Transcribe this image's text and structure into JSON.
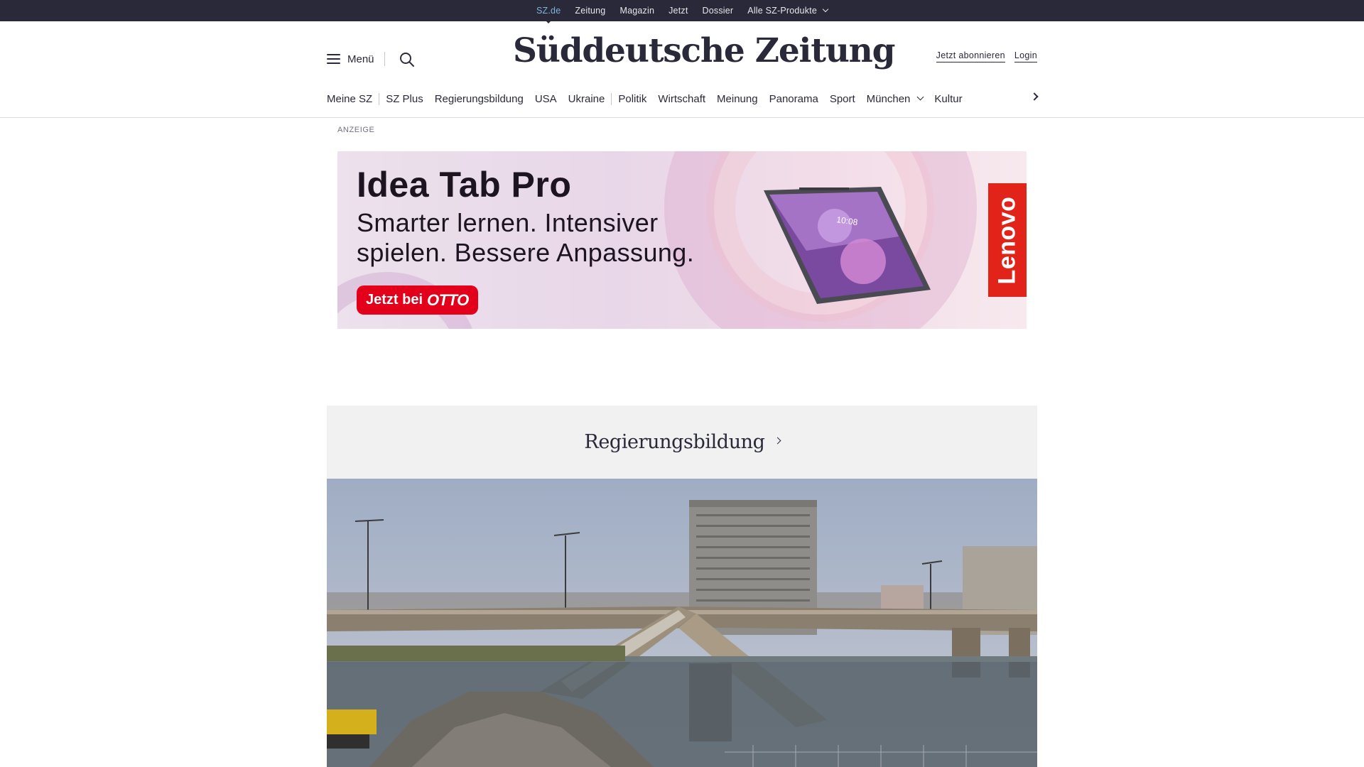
{
  "topbar": {
    "links": [
      "SZ.de",
      "Zeitung",
      "Magazin",
      "Jetzt",
      "Dossier",
      "Alle SZ-Produkte"
    ]
  },
  "header": {
    "menu_label": "Menü",
    "logo_text": "Süddeutsche Zeitung",
    "subscribe": "Jetzt abonnieren",
    "login": "Login"
  },
  "nav": {
    "items": [
      "Meine SZ",
      "SZ Plus",
      "Regierungsbildung",
      "USA",
      "Ukraine",
      "Politik",
      "Wirtschaft",
      "Meinung",
      "Panorama",
      "Sport",
      "München",
      "Kultur"
    ]
  },
  "ad": {
    "label": "ANZEIGE",
    "title": "Idea Tab Pro",
    "subtitle": "Smarter lernen. Intensiver spielen. Bessere Anpassung.",
    "cta_prefix": "Jetzt bei",
    "cta_brand": "OTTO",
    "tablet_time": "10:08",
    "brand": "Lenovo"
  },
  "topic": {
    "title": "Regierungsbildung"
  },
  "colors": {
    "topbar_bg": "#29293a",
    "accent_link": "#7fb6d4",
    "cta_red": "#e2001a",
    "lenovo_red": "#e2231a",
    "topic_bg": "#f1f1f1"
  },
  "icons": [
    "hamburger-icon",
    "search-icon",
    "chevron-down-icon",
    "chevron-right-icon"
  ]
}
